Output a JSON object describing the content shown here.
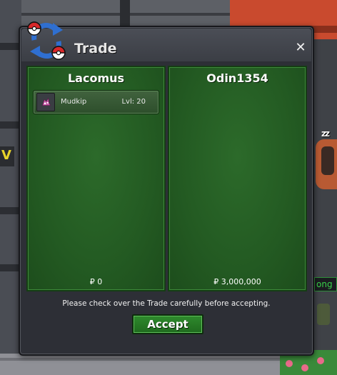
{
  "window": {
    "title": "Trade",
    "close_glyph": "✕",
    "logo_icon": "trade-exchange-icon"
  },
  "panels": [
    {
      "trainer": "Lacomus",
      "items": [
        {
          "icon": "mudkip-icon",
          "name": "Mudkip",
          "level": "Lvl: 20"
        }
      ],
      "money": "₽ 0"
    },
    {
      "trainer": "Odin1354",
      "items": [],
      "money": "₽ 3,000,000"
    }
  ],
  "notice": "Please check over the Trade carefully before accepting.",
  "accept_label": "Accept",
  "background": {
    "status_text": "ong",
    "sleep_text": "zz"
  },
  "colors": {
    "panel_green": "#235a22",
    "button_green": "#2f8a2d",
    "window_dark": "#2d2f36",
    "logo_blue": "#2f6fd0",
    "logo_red": "#d8282a"
  }
}
